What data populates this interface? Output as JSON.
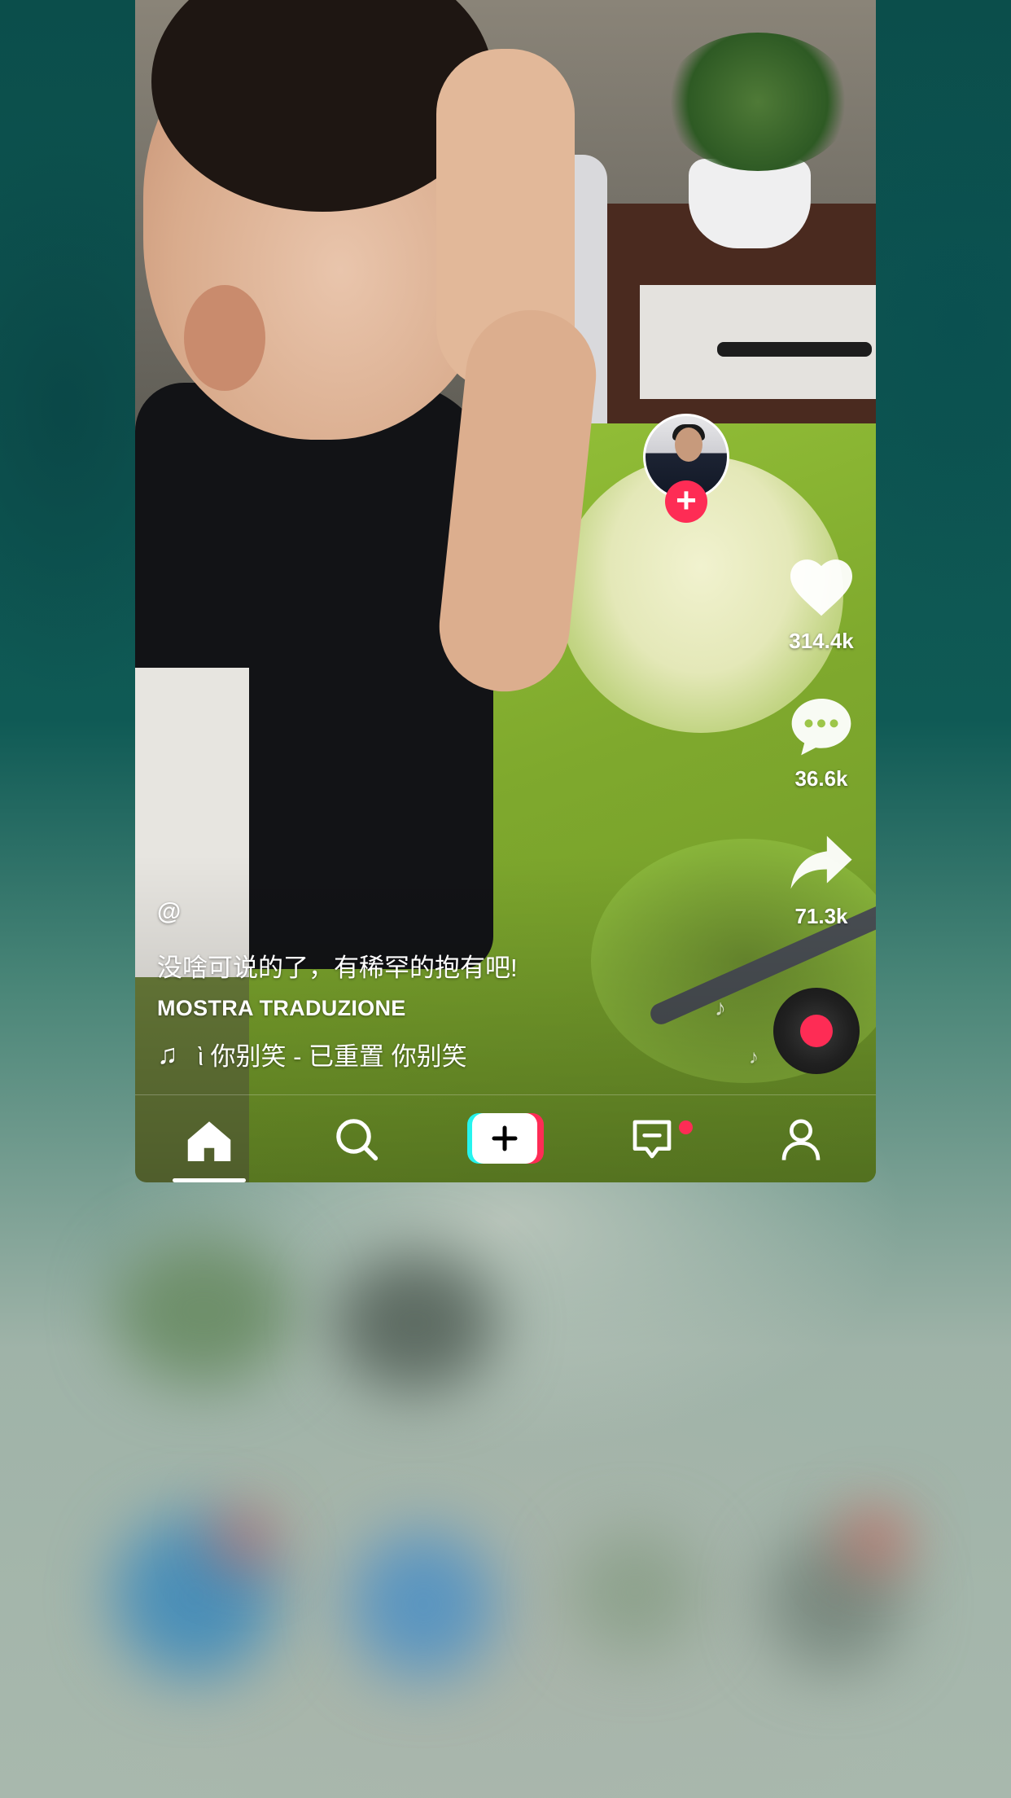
{
  "video": {
    "username": "@",
    "caption": "没啥可说的了，有稀罕的抱有吧!",
    "translate_label": "MOSTRA TRADUZIONE",
    "music_note": "♫",
    "music_text": "ὶ  你别笑 - 已重置   你别笑"
  },
  "rail": {
    "likes": "314.4k",
    "comments": "36.6k",
    "shares": "71.3k"
  },
  "nav": {
    "items": [
      {
        "name": "home",
        "icon": "home-icon",
        "active": true
      },
      {
        "name": "discover",
        "icon": "search-icon",
        "active": false
      },
      {
        "name": "create",
        "icon": "plus-icon",
        "active": false
      },
      {
        "name": "inbox",
        "icon": "message-icon",
        "active": false,
        "badge": true
      },
      {
        "name": "profile",
        "icon": "person-icon",
        "active": false
      }
    ]
  },
  "colors": {
    "accent": "#fe2c55",
    "cyan": "#25f4ee"
  }
}
